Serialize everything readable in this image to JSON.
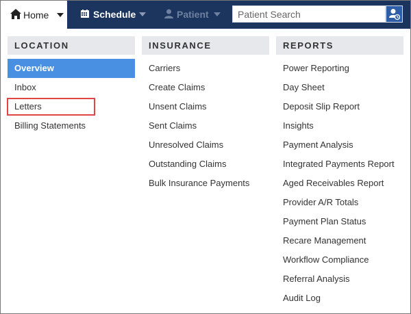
{
  "nav": {
    "home_label": "Home",
    "schedule_label": "Schedule",
    "patient_label": "Patient",
    "search_placeholder": "Patient Search",
    "colors": {
      "bar": "#1c355e",
      "accent": "#4a90e2",
      "search_button": "#2f5ea8",
      "highlight": "#e04545"
    }
  },
  "location": {
    "header": "LOCATION",
    "items": [
      "Overview",
      "Inbox",
      "Letters",
      "Billing Statements"
    ],
    "active": "Overview",
    "highlighted": "Letters"
  },
  "insurance": {
    "header": "INSURANCE",
    "items": [
      "Carriers",
      "Create Claims",
      "Unsent Claims",
      "Sent Claims",
      "Unresolved Claims",
      "Outstanding Claims",
      "Bulk Insurance Payments"
    ]
  },
  "reports": {
    "header": "REPORTS",
    "items": [
      "Power Reporting",
      "Day Sheet",
      "Deposit Slip Report",
      "Insights",
      "Payment Analysis",
      "Integrated Payments Report",
      "Aged Receivables Report",
      "Provider A/R Totals",
      "Payment Plan Status",
      "Recare Management",
      "Workflow Compliance",
      "Referral Analysis",
      "Audit Log"
    ]
  }
}
